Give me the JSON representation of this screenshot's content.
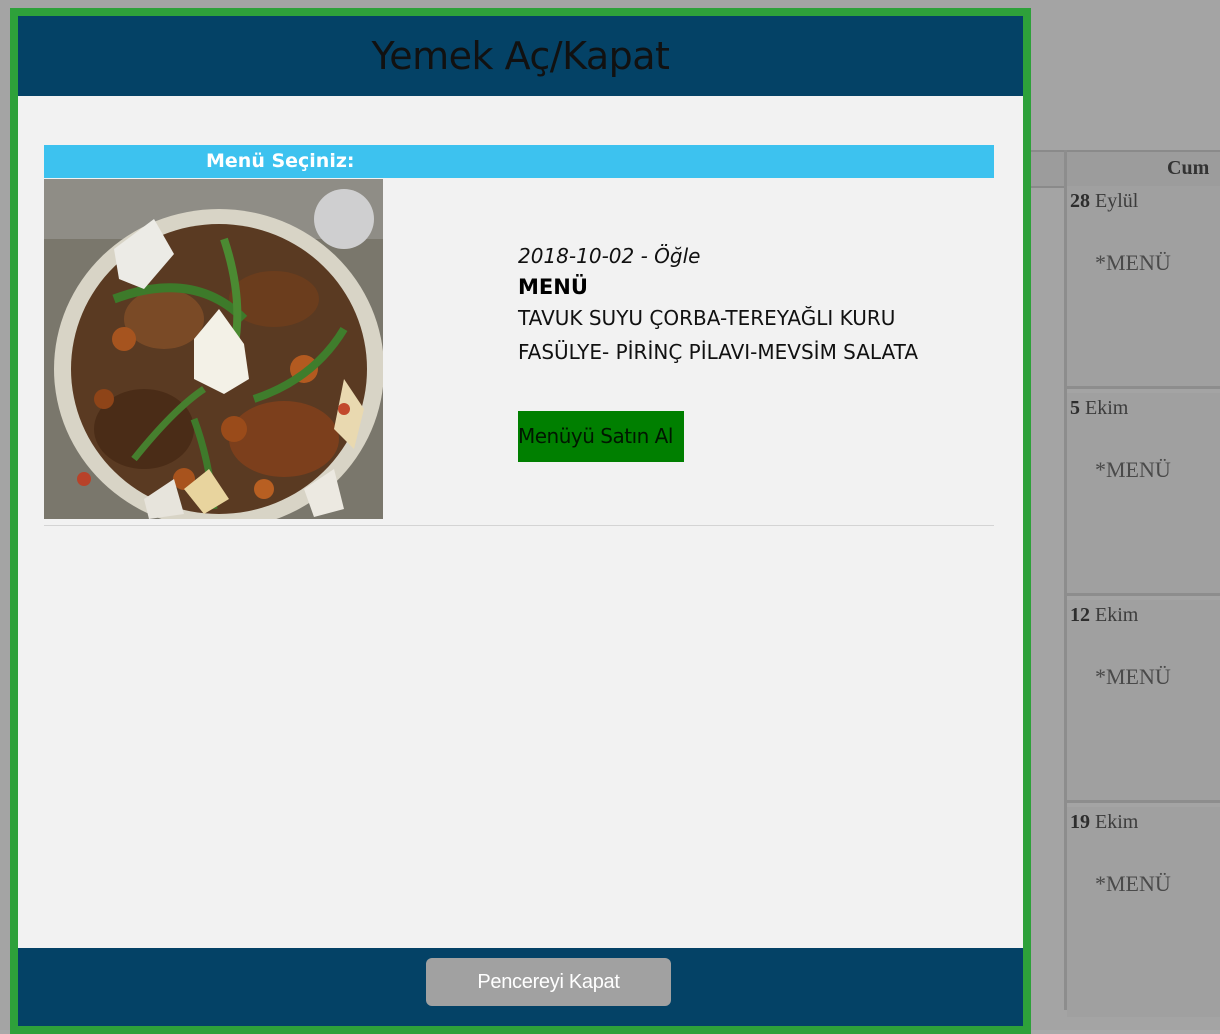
{
  "modal": {
    "title": "Yemek Aç/Kapat",
    "section_label": "Menü Seçiniz:",
    "meal": {
      "date_time": "2018-10-02 - Öğle",
      "title": "MENÜ",
      "items": "TAVUK SUYU ÇORBA-TEREYAĞLI KURU FASÜLYE- PİRİNÇ PİLAVI-MEVSİM SALATA",
      "buy_label": "Menüyü Satın Al"
    },
    "close_label": "Pencereyi Kapat"
  },
  "calendar": {
    "header_label": "Cum",
    "days": [
      {
        "day": "28",
        "month": "Eylül",
        "menu": "*MENÜ"
      },
      {
        "day": "5",
        "month": "Ekim",
        "menu": "*MENÜ"
      },
      {
        "day": "12",
        "month": "Ekim",
        "menu": "*MENÜ"
      },
      {
        "day": "19",
        "month": "Ekim",
        "menu": "*MENÜ"
      }
    ]
  },
  "colors": {
    "modal_border": "#2ea13a",
    "header_bg": "#044266",
    "section_bar": "#3dc2ef",
    "buy_button": "#007f00",
    "close_button": "#a1a1a1"
  }
}
